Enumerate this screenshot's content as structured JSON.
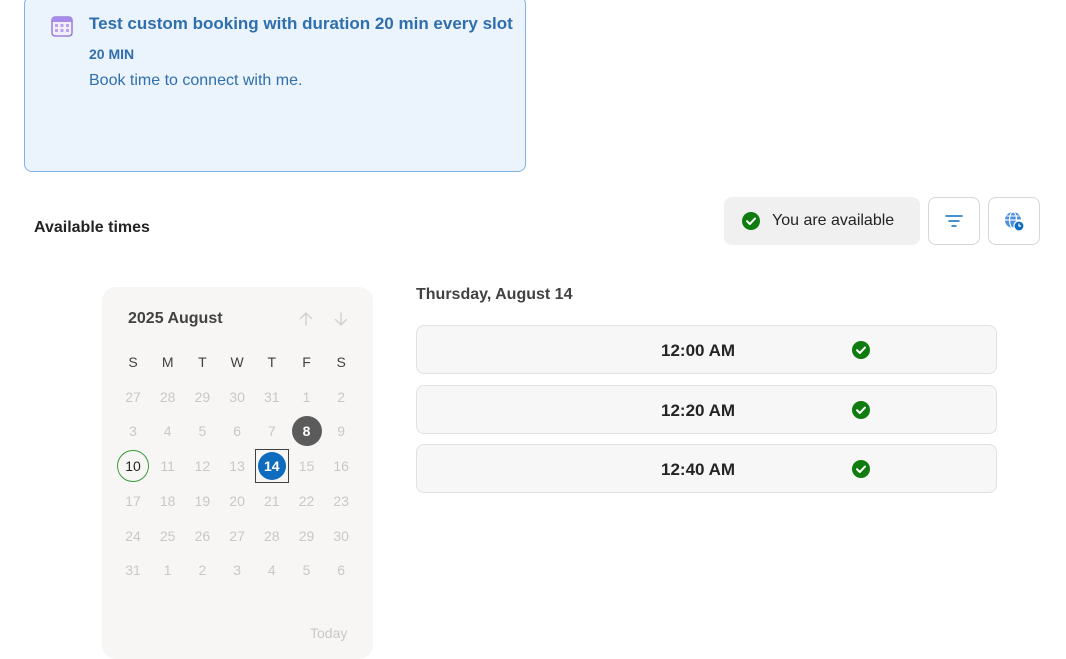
{
  "booking": {
    "title": "Test custom booking with duration 20 min every slot",
    "duration": "20 MIN",
    "description": "Book time to connect with me.",
    "icon": "calendar-icon"
  },
  "section_title": "Available times",
  "availability": {
    "label": "You are available",
    "icon": "check-circle-icon",
    "color": "#107c10"
  },
  "buttons": {
    "filter_icon": "filter-icon",
    "timezone_icon": "globe-clock-icon"
  },
  "calendar": {
    "month_label": "2025 August",
    "weekdays": [
      "S",
      "M",
      "T",
      "W",
      "T",
      "F",
      "S"
    ],
    "weeks": [
      [
        "27",
        "28",
        "29",
        "30",
        "31",
        "1",
        "2"
      ],
      [
        "3",
        "4",
        "5",
        "6",
        "7",
        "8",
        "9"
      ],
      [
        "10",
        "11",
        "12",
        "13",
        "14",
        "15",
        "16"
      ],
      [
        "17",
        "18",
        "19",
        "20",
        "21",
        "22",
        "23"
      ],
      [
        "24",
        "25",
        "26",
        "27",
        "28",
        "29",
        "30"
      ],
      [
        "31",
        "1",
        "2",
        "3",
        "4",
        "5",
        "6"
      ]
    ],
    "today": "10",
    "available_days": [
      "8"
    ],
    "selected_day": "14",
    "today_link": "Today",
    "accent": "#0f6cbd"
  },
  "slots": {
    "date_heading": "Thursday, August 14",
    "times": [
      "12:00 AM",
      "12:20 AM",
      "12:40 AM"
    ]
  }
}
